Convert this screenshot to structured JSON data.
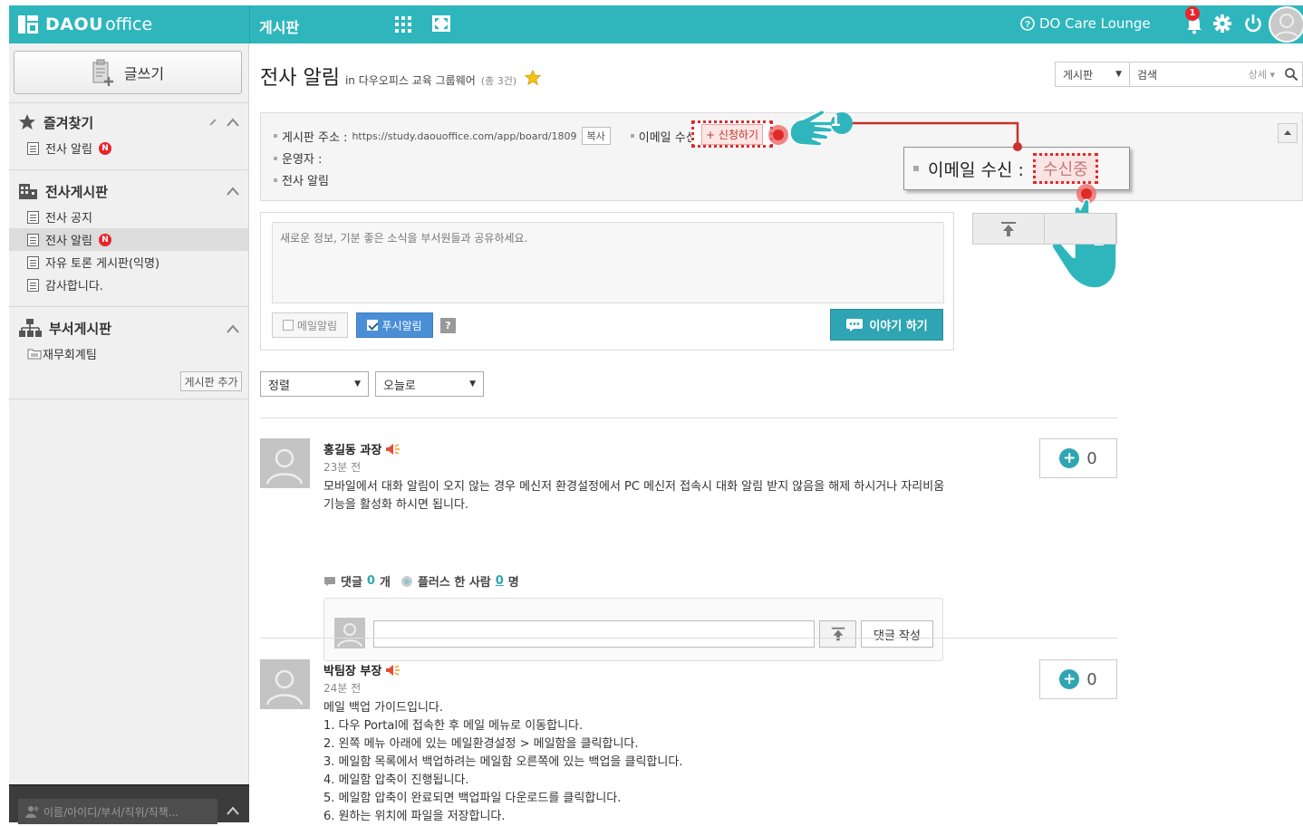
{
  "app": {
    "brand_bold": "DAOU",
    "brand_light": "office",
    "section_title": "게시판",
    "care_link": "DO Care Lounge",
    "notification_count": "1",
    "accent_color": "#2fb6bd"
  },
  "sidebar": {
    "write_label": "글쓰기",
    "favorites": {
      "title": "즐겨찾기",
      "items": [
        {
          "label": "전사 알림",
          "badge": "N"
        }
      ]
    },
    "company_boards": {
      "title": "전사게시판",
      "items": [
        {
          "label": "전사 공지"
        },
        {
          "label": "전사 알림",
          "badge": "N"
        },
        {
          "label": "자유 토론 게시판(익명)"
        },
        {
          "label": "감사합니다."
        }
      ]
    },
    "dept_boards": {
      "title": "부서게시판",
      "items": [
        {
          "label": "재무회계팀"
        }
      ],
      "add_label": "게시판 추가"
    },
    "search_placeholder": "이름/아이디/부서/직위/직책..."
  },
  "header": {
    "title": "전사 알림",
    "in_label": "in 다우오피스 교육 그룹웨어",
    "count_label": "(총 3건)",
    "search_scope": "게시판",
    "search_placeholder": "검색",
    "advanced_label": "상세"
  },
  "info": {
    "address_label": "게시판 주소 :",
    "address_url": "https://study.daouoffice.com/app/board/1809",
    "copy_label": "복사",
    "email_label": "이메일 수신 :",
    "subscribe_label": "+ 신청하기",
    "operator_label": "운영자 :",
    "desc": "전사 알림"
  },
  "callout": {
    "step1": "1",
    "step2": "2",
    "label": "이메일 수신 :",
    "status": "수신중"
  },
  "composer": {
    "placeholder": "새로운 정보, 기분 좋은 소식을 부서원들과 공유하세요.",
    "mail_alarm": "메일알림",
    "push_alarm": "푸시알림",
    "help": "?",
    "submit": "이야기 하기"
  },
  "filters": {
    "sort": "정렬",
    "period": "오늘로"
  },
  "posts": [
    {
      "author": "홍길동 과장",
      "time": "23분 전",
      "body": "모바일에서 대화 알림이 오지 않는 경우 메신저 환경설정에서 PC 메신저 접속시 대화 알림 받지 않음을 해제 하시거나 자리비움 기능을 활성화 하시면 됩니다.",
      "plus_count": "0",
      "comments_label": "댓글",
      "comments_count": "0",
      "comments_unit": "개",
      "plus_people_label": "플러스 한 사람",
      "plus_people_count": "0",
      "plus_people_unit": "명",
      "comment_submit": "댓글 작성"
    },
    {
      "author": "박팀장 부장",
      "time": "24분 전",
      "body_lines": [
        "메일 백업 가이드입니다.",
        "1. 다우 Portal에 접속한 후 메일 메뉴로 이동합니다.",
        "2. 왼쪽 메뉴 아래에 있는 메일환경설정 > 메일함을 클릭합니다.",
        "3. 메일함 목록에서 백업하려는 메일함 오른쪽에 있는 백업을 클릭합니다.",
        "4. 메일함 압축이 진행됩니다.",
        "5. 메일함 압축이 완료되면 백업파일 다운로드를 클릭합니다.",
        "6. 원하는 위치에 파일을 저장합니다."
      ],
      "plus_count": "0"
    }
  ]
}
